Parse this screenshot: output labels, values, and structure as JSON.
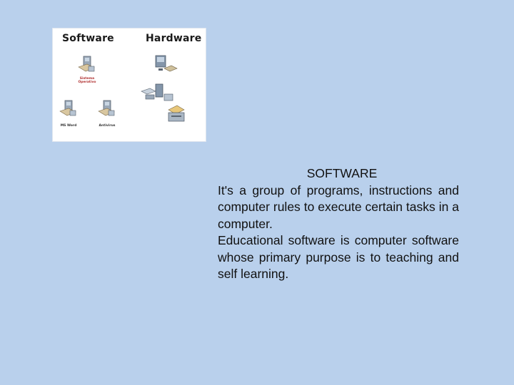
{
  "figure": {
    "software_title": "Software",
    "hardware_title": "Hardware",
    "software_items": [
      {
        "label": "Sistema Operativo"
      },
      {
        "label": "MS Word"
      },
      {
        "label": "Antivirus"
      }
    ],
    "colors": {
      "label_red": "#b03030"
    }
  },
  "content": {
    "heading": "SOFTWARE",
    "paragraphs": [
      "It's a group of programs, instructions and computer rules to execute certain tasks in a computer.",
      "Educational software is computer software whose primary purpose is to teaching and self learning."
    ]
  },
  "colors": {
    "background": "#b9d0ec",
    "text": "#111111"
  }
}
